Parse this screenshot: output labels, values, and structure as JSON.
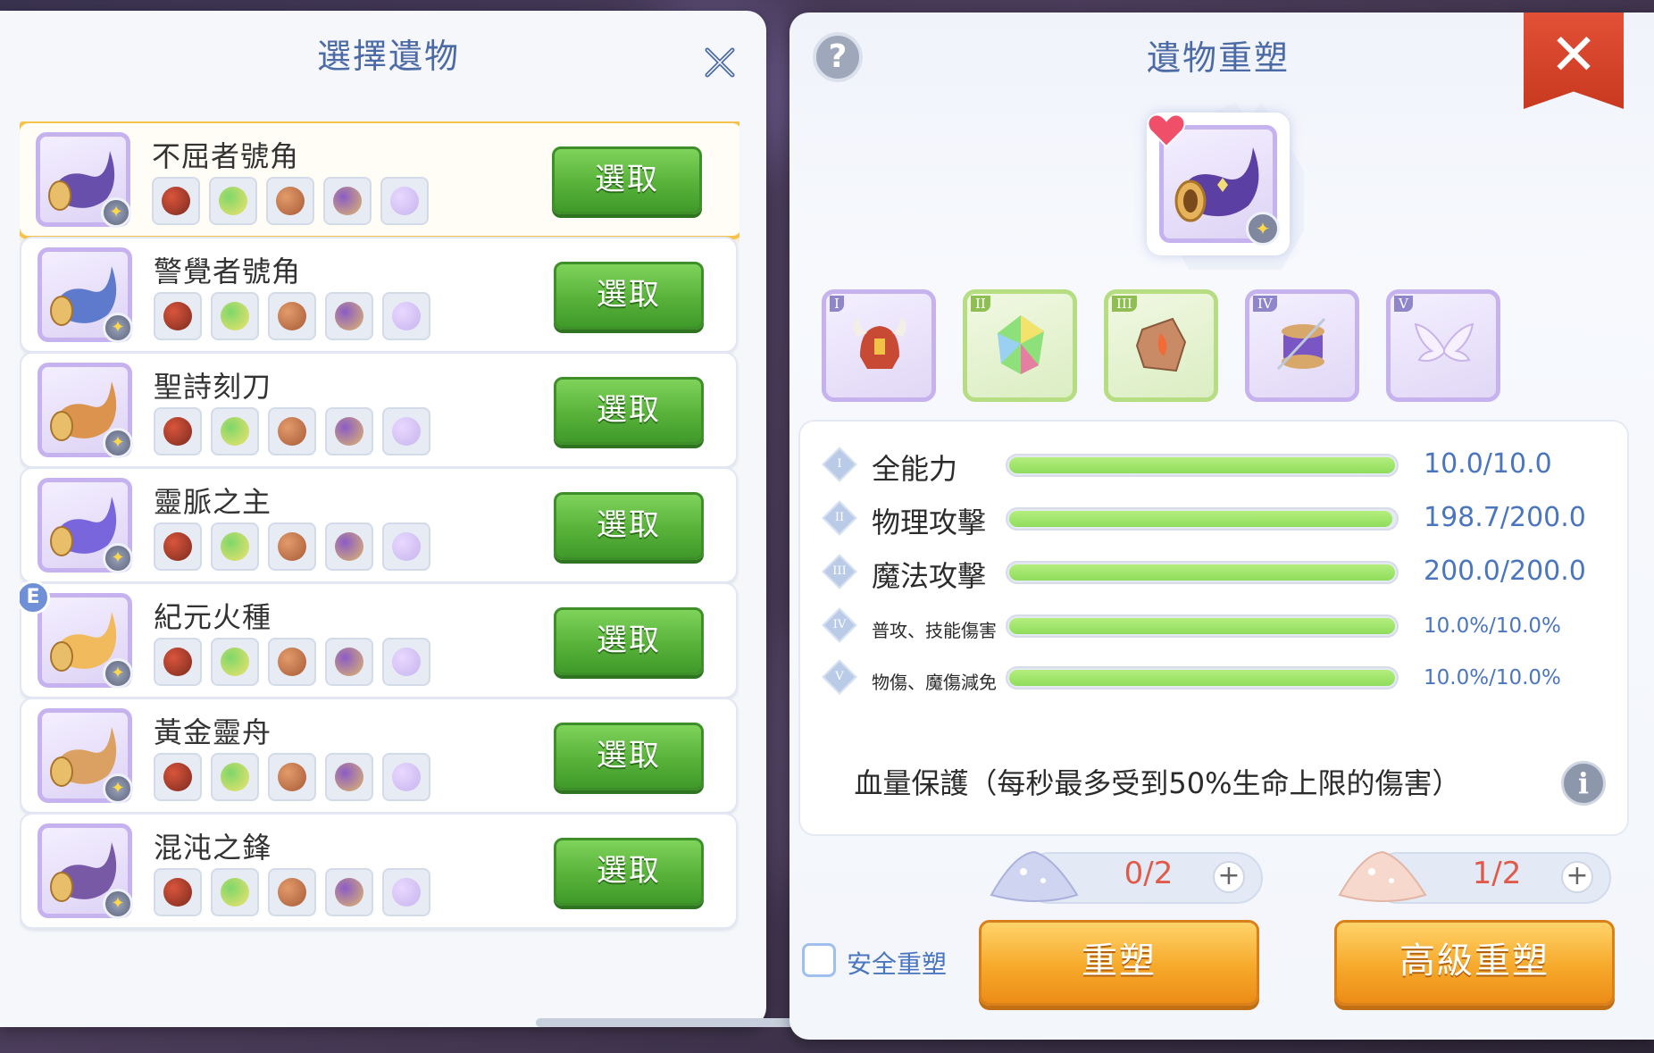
{
  "left_panel": {
    "title": "選擇遺物",
    "relics": [
      {
        "name": "不屈者號角",
        "button": "選取",
        "selected": true,
        "badge": ""
      },
      {
        "name": "警覺者號角",
        "button": "選取",
        "selected": false,
        "badge": ""
      },
      {
        "name": "聖詩刻刀",
        "button": "選取",
        "selected": false,
        "badge": ""
      },
      {
        "name": "靈脈之主",
        "button": "選取",
        "selected": false,
        "badge": ""
      },
      {
        "name": "紀元火種",
        "button": "選取",
        "selected": false,
        "badge": "E"
      },
      {
        "name": "黃金靈舟",
        "button": "選取",
        "selected": false,
        "badge": ""
      },
      {
        "name": "混沌之鋒",
        "button": "選取",
        "selected": false,
        "badge": ""
      }
    ]
  },
  "right_panel": {
    "help_icon": "?",
    "title": "遺物重塑",
    "close_icon": "✕",
    "parts": [
      {
        "roman": "I",
        "icon": "horned-helmet-icon",
        "color": "#c5b2ef"
      },
      {
        "roman": "II",
        "icon": "rainbow-crystal-icon",
        "color": "#b7dd82"
      },
      {
        "roman": "III",
        "icon": "flame-stone-icon",
        "color": "#b7dd82"
      },
      {
        "roman": "IV",
        "icon": "thread-spool-icon",
        "color": "#c5b2ef"
      },
      {
        "roman": "V",
        "icon": "angel-wings-icon",
        "color": "#c5b2ef"
      }
    ],
    "stats": [
      {
        "roman": "I",
        "label": "全能力",
        "value": "10.0/10.0",
        "fill": 1.0,
        "size": "big"
      },
      {
        "roman": "II",
        "label": "物理攻擊",
        "value": "198.7/200.0",
        "fill": 0.9935,
        "size": "big"
      },
      {
        "roman": "III",
        "label": "魔法攻擊",
        "value": "200.0/200.0",
        "fill": 1.0,
        "size": "big"
      },
      {
        "roman": "IV",
        "label": "普攻、技能傷害",
        "value": "10.0%/10.0%",
        "fill": 1.0,
        "size": "small"
      },
      {
        "roman": "V",
        "label": "物傷、魔傷減免",
        "value": "10.0%/10.0%",
        "fill": 1.0,
        "size": "small"
      }
    ],
    "protection": "血量保護（每秒最多受到50%生命上限的傷害）",
    "info_icon": "i",
    "materials": [
      {
        "count": "0/2",
        "color": "#cfd4f0",
        "plus": "+"
      },
      {
        "count": "1/2",
        "color": "#f6d8cc",
        "plus": "+"
      }
    ],
    "safe_label": "安全重塑",
    "reforge_button": "重塑",
    "advanced_reforge_button": "高級重塑"
  },
  "colors": {
    "title_blue": "#4b6aa6",
    "select_green": "#58b23a",
    "orange": "#f6a92a",
    "close_red": "#d8432a"
  }
}
